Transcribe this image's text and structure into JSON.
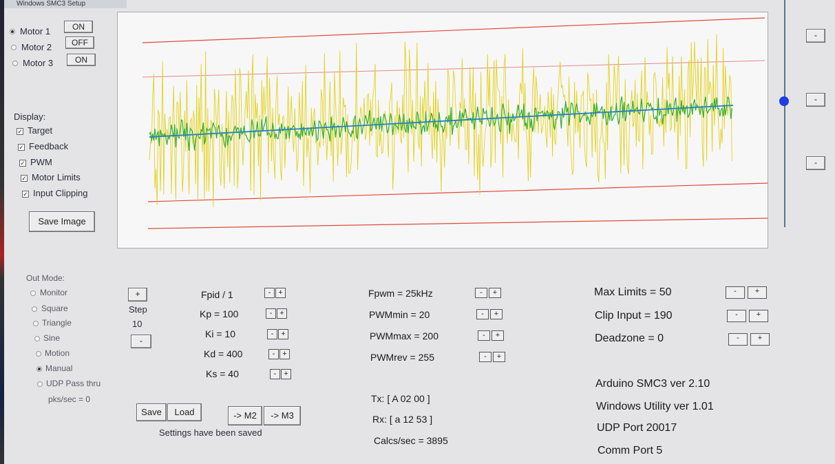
{
  "window": {
    "title": "Windows SMC3 Setup"
  },
  "motors": [
    {
      "label": "Motor 1",
      "button": "ON",
      "selected": true
    },
    {
      "label": "Motor 2",
      "button": "OFF",
      "selected": false
    },
    {
      "label": "Motor 3",
      "button": "ON",
      "selected": false
    }
  ],
  "display": {
    "heading": "Display:",
    "items": [
      {
        "label": "Target",
        "checked": true
      },
      {
        "label": "Feedback",
        "checked": true
      },
      {
        "label": "PWM",
        "checked": true
      },
      {
        "label": "Motor Limits",
        "checked": true
      },
      {
        "label": "Input Clipping",
        "checked": true
      }
    ],
    "save_image_label": "Save Image"
  },
  "out_mode": {
    "heading": "Out Mode:",
    "options": [
      {
        "label": "Monitor",
        "selected": false
      },
      {
        "label": "Square",
        "selected": false
      },
      {
        "label": "Triangle",
        "selected": false
      },
      {
        "label": "Sine",
        "selected": false
      },
      {
        "label": "Motion",
        "selected": false
      },
      {
        "label": "Manual",
        "selected": true
      },
      {
        "label": "UDP Pass thru",
        "selected": false
      }
    ],
    "pks_sec": "pks/sec = 0"
  },
  "step": {
    "plus": "+",
    "label": "Step",
    "value": "10",
    "minus": "-"
  },
  "pid": {
    "fpid": "Fpid / 1",
    "kp": "Kp = 100",
    "ki": "Ki = 10",
    "kd": "Kd = 400",
    "ks": "Ks = 40"
  },
  "pwm": {
    "fpwm": "Fpwm = 25kHz",
    "min": "PWMmin = 20",
    "max": "PWMmax = 200",
    "rev": "PWMrev = 255"
  },
  "limits": {
    "max": "Max Limits = 50",
    "clip": "Clip Input = 190",
    "deadzone": "Deadzone = 0"
  },
  "buttons": {
    "save": "Save",
    "load": "Load",
    "to_m2": "-> M2",
    "to_m3": "-> M3",
    "minus": "-",
    "plus": "+"
  },
  "status": {
    "settings": "Settings have been saved",
    "tx": "Tx: [ A 02 00 ]",
    "rx": "Rx: [ a 12 53 ]",
    "calcs": "Calcs/sec = 3895"
  },
  "info": {
    "arduino": "Arduino SMC3 ver 2.10",
    "utility": "Windows Utility ver 1.01",
    "udp": "UDP Port 20017",
    "comm": "Comm Port 5"
  },
  "slider": {
    "level": 0.45
  },
  "colors": {
    "pwm": "#e3d21a",
    "feedback": "#2fae2f",
    "target": "#2a7fbf",
    "limit": "#e04a3a",
    "clip": "#e08a8a",
    "slider_thumb": "#1f3fe0"
  }
}
